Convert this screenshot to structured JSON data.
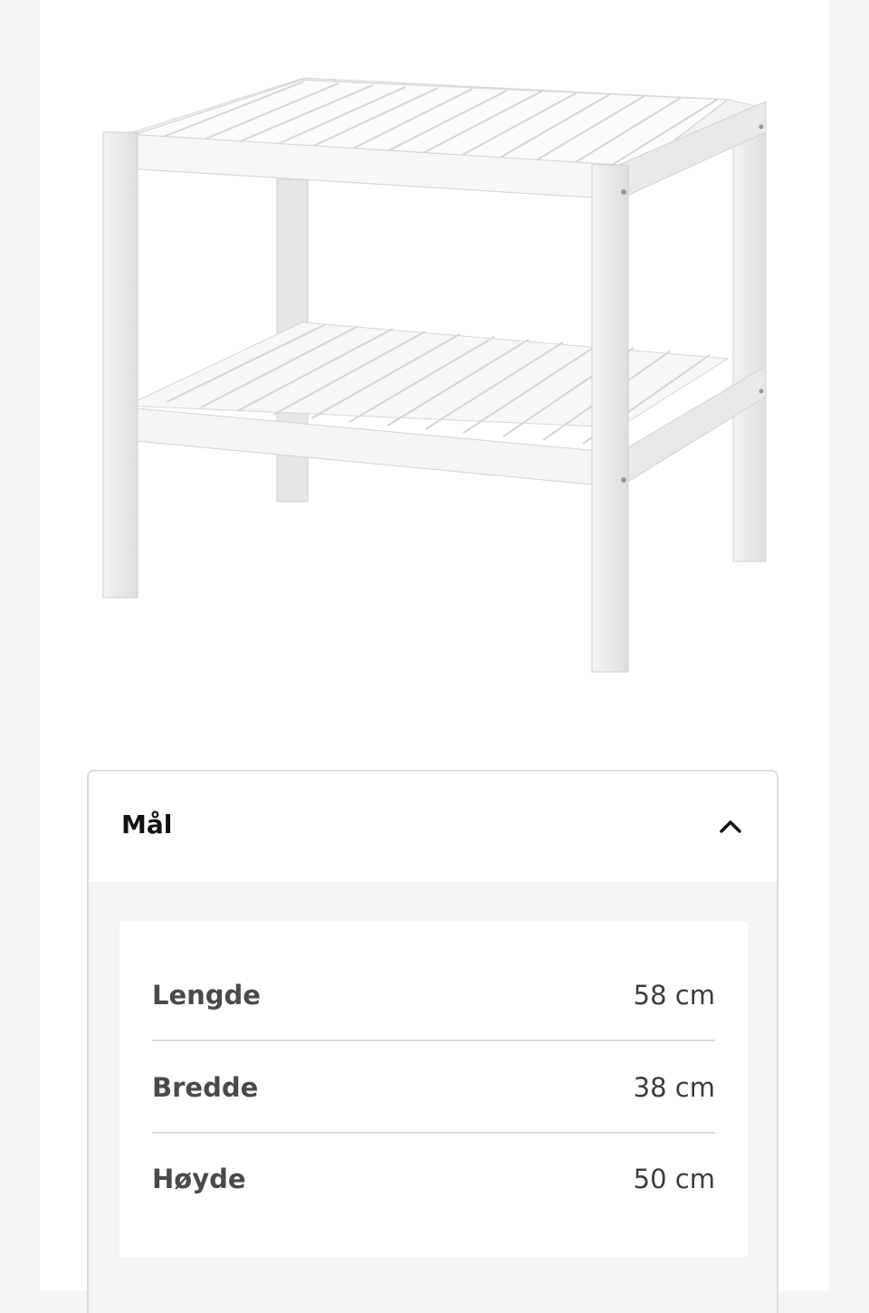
{
  "product": {
    "image_name": "white slatted bathroom bench"
  },
  "accordion": {
    "title": "Mål",
    "toggle_icon": "chevron-up-icon",
    "expanded": true
  },
  "dimensions": [
    {
      "label": "Lengde",
      "value": "58 cm"
    },
    {
      "label": "Bredde",
      "value": "38 cm"
    },
    {
      "label": "Høyde",
      "value": "50 cm"
    }
  ],
  "colors": {
    "page_bg": "#f5f5f5",
    "card_bg": "#ffffff",
    "label_text": "#4a4a4a",
    "divider": "#dcdcdc"
  }
}
